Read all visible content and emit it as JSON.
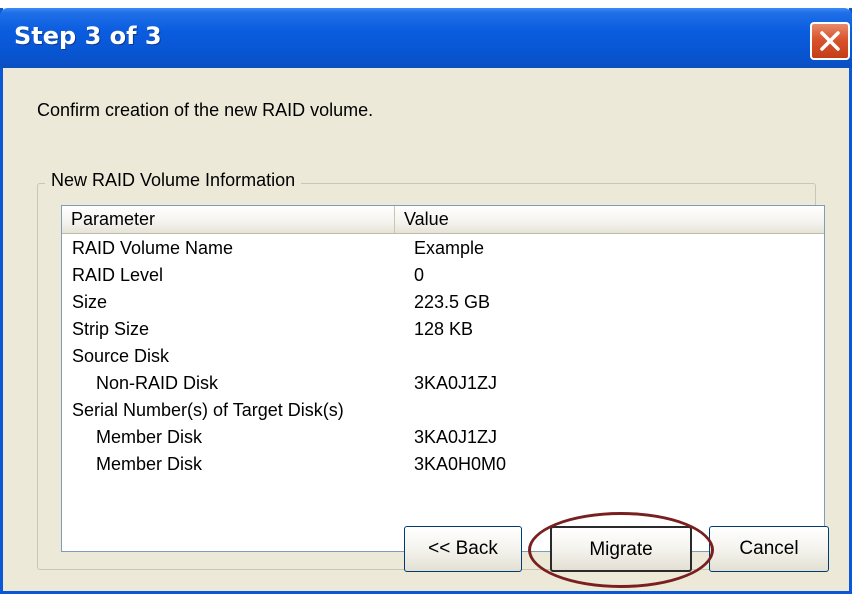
{
  "window": {
    "title": "Step 3 of 3"
  },
  "instruction": "Confirm creation of the new RAID volume.",
  "group": {
    "legend": "New RAID Volume Information",
    "columns": [
      "Parameter",
      "Value"
    ],
    "rows": [
      {
        "param": "RAID Volume Name",
        "value": "Example"
      },
      {
        "param": "RAID Level",
        "value": "0"
      },
      {
        "param": "Size",
        "value": "223.5 GB"
      },
      {
        "param": "Strip Size",
        "value": "128 KB"
      },
      {
        "param": "Source Disk",
        "value": ""
      },
      {
        "param": "Non-RAID Disk",
        "value": "3KA0J1ZJ"
      },
      {
        "param": "Serial Number(s) of Target Disk(s)",
        "value": ""
      },
      {
        "param": "Member Disk",
        "value": "3KA0J1ZJ"
      },
      {
        "param": "Member Disk",
        "value": "3KA0H0M0"
      }
    ]
  },
  "buttons": {
    "back": "<< Back",
    "migrate": "Migrate",
    "cancel": "Cancel"
  },
  "icons": {
    "close": "close-icon"
  },
  "colors": {
    "titlebar": "#0a5cdf",
    "close": "#d9542c",
    "highlight": "#7a1f1f"
  }
}
